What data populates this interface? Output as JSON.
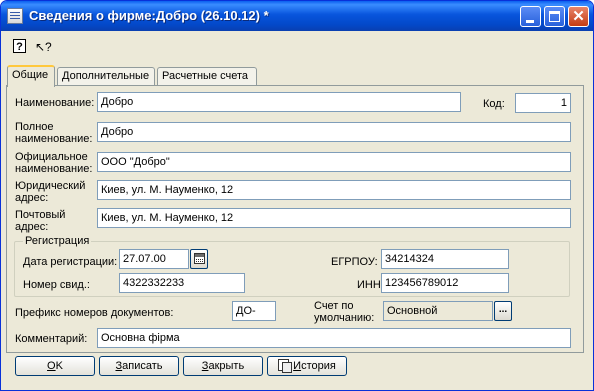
{
  "window": {
    "title": "Сведения о фирме:Добро (26.10.12) *"
  },
  "toolbar": {
    "help_glyph": "?",
    "whats_this_glyph": "↖?"
  },
  "tabs": [
    {
      "label": "Общие",
      "active": true
    },
    {
      "label": "Дополнительные",
      "active": false
    },
    {
      "label": "Расчетные счета",
      "active": false
    }
  ],
  "form": {
    "name_label": "Наименование:",
    "name_value": "Добро",
    "code_label": "Код:",
    "code_value": "1",
    "full_name_label_1": "Полное",
    "full_name_label_2": "наименование:",
    "full_name_value": "Добро",
    "official_name_label_1": "Официальное",
    "official_name_label_2": "наименование:",
    "official_name_value": "ООО \"Добро\"",
    "legal_address_label_1": "Юридический",
    "legal_address_label_2": "адрес:",
    "legal_address_value": "Киев, ул. М. Науменко, 12",
    "postal_address_label_1": "Почтовый",
    "postal_address_label_2": "адрес:",
    "postal_address_value": "Киев, ул. М. Науменко, 12",
    "registration_group_title": "Регистрация",
    "reg_date_label": "Дата регистрации:",
    "reg_date_value": "27.07.00",
    "cert_number_label": "Номер свид.:",
    "cert_number_value": "4322332233",
    "egrpou_label": "ЕГРПОУ:",
    "egrpou_value": "34214324",
    "inn_label": "ИНН:",
    "inn_value": "123456789012",
    "doc_prefix_label": "Префикс номеров документов:",
    "doc_prefix_value": "ДО-",
    "default_account_label_1": "Счет по",
    "default_account_label_2": "умолчанию:",
    "default_account_value": "Основной",
    "select_button_glyph": "...",
    "comment_label": "Комментарий:",
    "comment_value": "Основна фірма"
  },
  "buttons": {
    "ok_hotkey": "O",
    "ok_rest": "K",
    "save_hotkey": "З",
    "save_rest": "аписать",
    "close_hotkey": "З",
    "close_rest": "акрыть",
    "history_hotkey": "И",
    "history_rest": "стория"
  },
  "colors": {
    "titlebar": "#0855DD",
    "window_bg": "#ECE9D8",
    "close_button": "#C43C13",
    "tab_highlight": "#FFC83C",
    "field_border": "#7F9DB9"
  }
}
